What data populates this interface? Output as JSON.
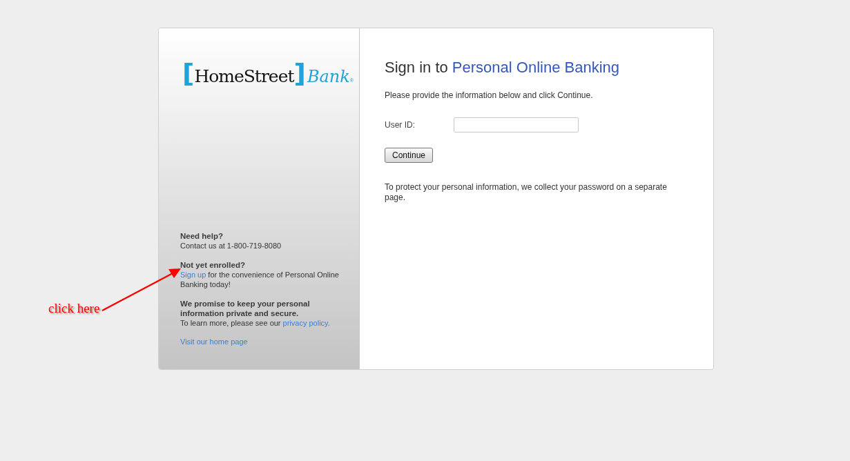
{
  "logo": {
    "bracket_open": "[",
    "name": "HomeStreet",
    "bracket_close": "]",
    "suffix": "Bank",
    "mark": "®"
  },
  "help": {
    "title": "Need help?",
    "text": "Contact us at 1-800-719-8080"
  },
  "enroll": {
    "title": "Not yet enrolled?",
    "link": "Sign up",
    "text": " for the convenience of Personal Online Banking today!"
  },
  "privacy": {
    "title": "We promise to keep your personal information private and secure.",
    "text": "To learn more, please see our ",
    "link": "privacy policy."
  },
  "home_link": "Visit our home page",
  "heading": {
    "text": "Sign in to ",
    "highlight": "Personal Online Banking"
  },
  "intro": "Please provide the information below and click Continue.",
  "user_id": {
    "label": "User ID:"
  },
  "continue_button": "Continue",
  "note": "To protect your personal information, we collect your password on a separate page.",
  "annotation": {
    "text": "click here"
  }
}
